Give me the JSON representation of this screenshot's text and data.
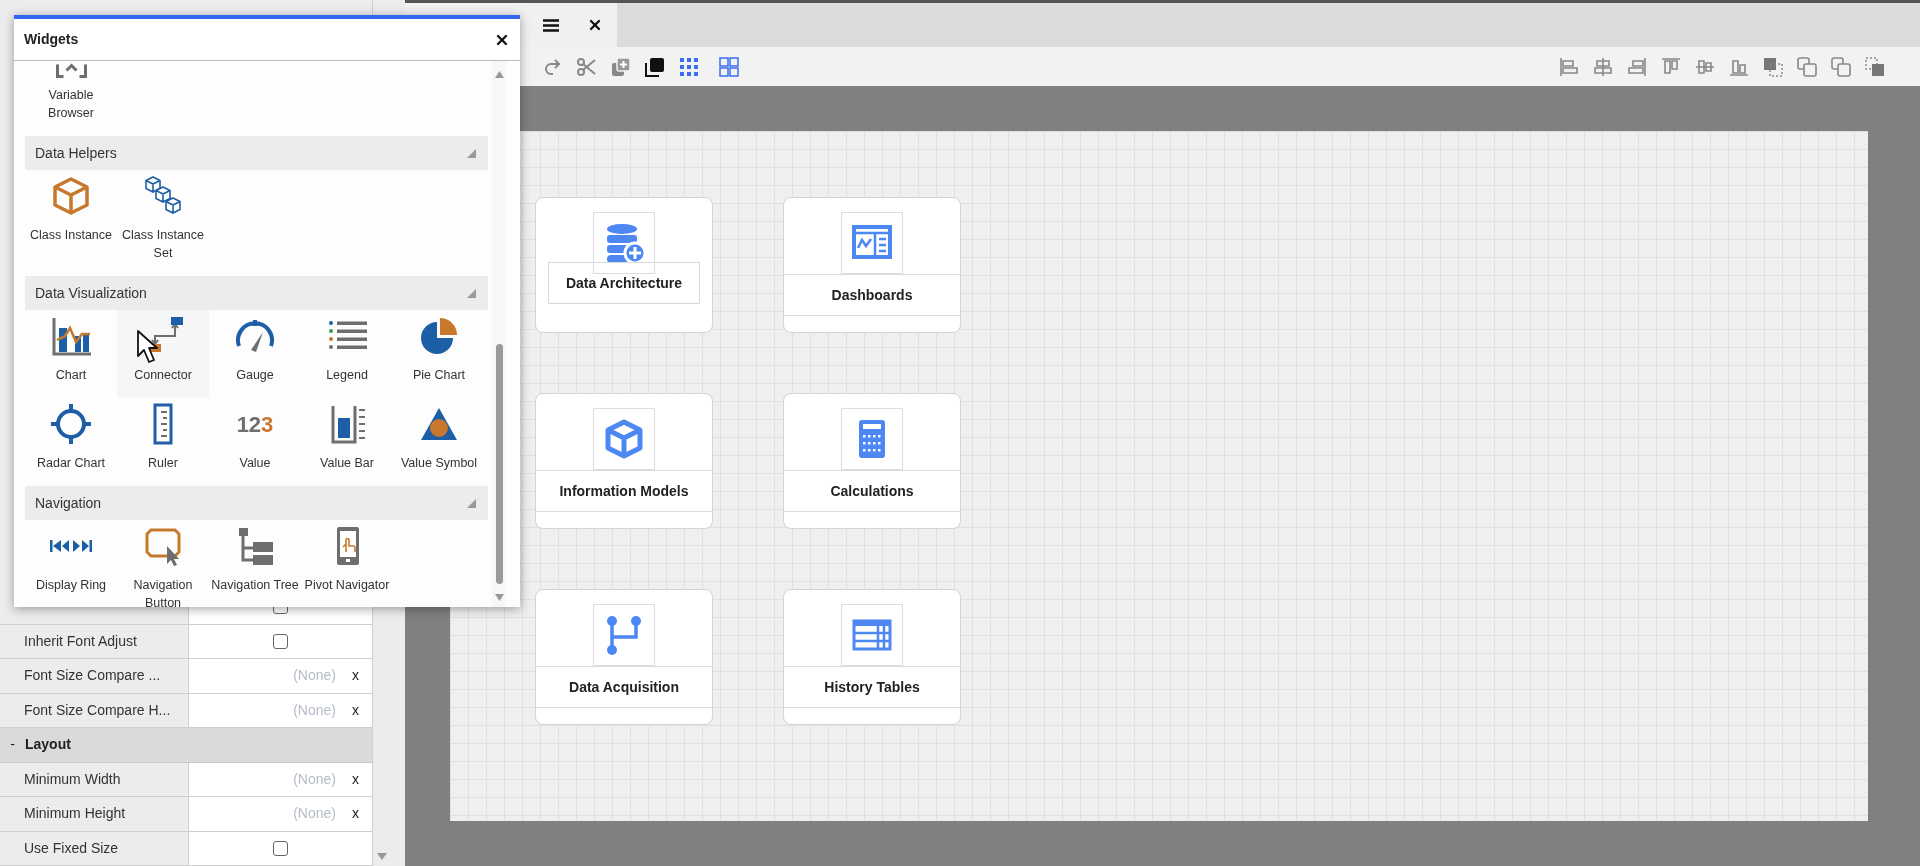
{
  "properties": {
    "rows": [
      {
        "kind": "checkbox",
        "checked": false
      },
      {
        "kind": "checkbox",
        "label": "Inherit Font Adjust",
        "checked": false
      },
      {
        "kind": "value",
        "label": "Font Size Compare ...",
        "value": "(None)",
        "clear": "x"
      },
      {
        "kind": "value",
        "label": "Font Size Compare H...",
        "value": "(None)",
        "clear": "x"
      },
      {
        "kind": "group",
        "toggle": "-",
        "label": "Layout"
      },
      {
        "kind": "value",
        "label": "Minimum Width",
        "value": "(None)",
        "clear": "x"
      },
      {
        "kind": "value",
        "label": "Minimum Height",
        "value": "(None)",
        "clear": "x"
      },
      {
        "kind": "checkbox",
        "label": "Use Fixed Size",
        "checked": false
      }
    ]
  },
  "widgets": {
    "title": "Widgets",
    "sections": [
      {
        "items": [
          {
            "kind": "variable-browser",
            "label": "Variable Browser",
            "hovered": false
          }
        ]
      },
      {
        "title": "Data Helpers",
        "expanded": true,
        "items": [
          {
            "kind": "cube",
            "label": "Class Instance",
            "hovered": false
          },
          {
            "kind": "cubes",
            "label": "Class Instance Set",
            "hovered": false
          }
        ]
      },
      {
        "title": "Data Visualization",
        "expanded": true,
        "items": [
          {
            "kind": "chart",
            "label": "Chart",
            "hovered": false
          },
          {
            "kind": "connector",
            "label": "Connector",
            "hovered": true
          },
          {
            "kind": "gauge",
            "label": "Gauge",
            "hovered": false
          },
          {
            "kind": "legend",
            "label": "Legend",
            "hovered": false
          },
          {
            "kind": "pie",
            "label": "Pie Chart",
            "hovered": false
          },
          {
            "kind": "radar",
            "label": "Radar Chart",
            "hovered": false
          },
          {
            "kind": "ruler",
            "label": "Ruler",
            "hovered": false
          },
          {
            "kind": "value",
            "label": "Value",
            "icon_text": [
              "12",
              "3"
            ],
            "hovered": false
          },
          {
            "kind": "value-bar",
            "label": "Value Bar",
            "hovered": false
          },
          {
            "kind": "value-symbol",
            "label": "Value Symbol",
            "hovered": false
          }
        ]
      },
      {
        "title": "Navigation",
        "expanded": true,
        "items": [
          {
            "kind": "display-ring",
            "label": "Display Ring",
            "hovered": false
          },
          {
            "kind": "nav-button",
            "label": "Navigation Button",
            "hovered": false
          },
          {
            "kind": "nav-tree",
            "label": "Navigation Tree",
            "hovered": false
          },
          {
            "kind": "pivot",
            "label": "Pivot Navigator",
            "hovered": false
          }
        ]
      }
    ]
  },
  "canvas": {
    "cards": [
      {
        "kind": "database",
        "label": "Data Architecture",
        "selected": true
      },
      {
        "kind": "dashboard",
        "label": "Dashboards",
        "selected": false
      },
      {
        "kind": "cube",
        "label": "Information Models",
        "selected": false
      },
      {
        "kind": "calculator",
        "label": "Calculations",
        "selected": false
      },
      {
        "kind": "branch",
        "label": "Data Acquisition",
        "selected": false
      },
      {
        "kind": "table",
        "label": "History Tables",
        "selected": false
      }
    ]
  }
}
